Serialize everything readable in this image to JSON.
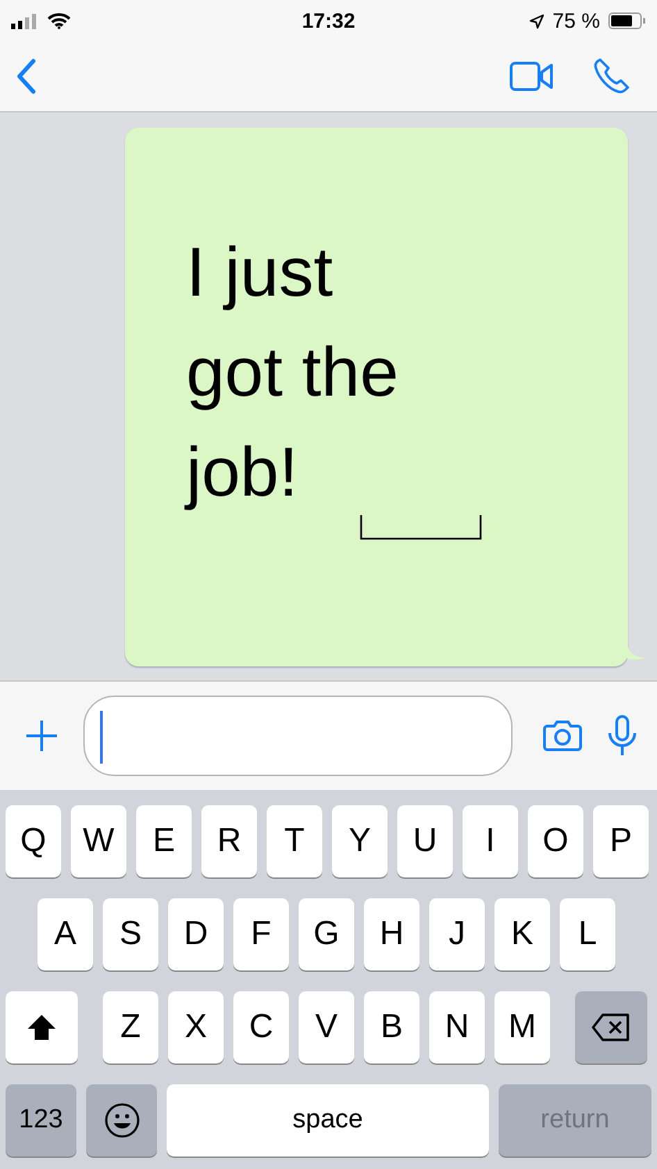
{
  "status_bar": {
    "time": "17:32",
    "battery": "75 %"
  },
  "message": {
    "text": "I just got the job!"
  },
  "keyboard": {
    "rows": [
      [
        {
          "kind": "letter",
          "label": "Q"
        },
        {
          "kind": "letter",
          "label": "W"
        },
        {
          "kind": "letter",
          "label": "E"
        },
        {
          "kind": "letter",
          "label": "R"
        },
        {
          "kind": "letter",
          "label": "T"
        },
        {
          "kind": "letter",
          "label": "Y"
        },
        {
          "kind": "letter",
          "label": "U"
        },
        {
          "kind": "letter",
          "label": "I"
        },
        {
          "kind": "letter",
          "label": "O"
        },
        {
          "kind": "letter",
          "label": "P"
        }
      ],
      [
        {
          "kind": "letter",
          "label": "A"
        },
        {
          "kind": "letter",
          "label": "S"
        },
        {
          "kind": "letter",
          "label": "D"
        },
        {
          "kind": "letter",
          "label": "F"
        },
        {
          "kind": "letter",
          "label": "G"
        },
        {
          "kind": "letter",
          "label": "H"
        },
        {
          "kind": "letter",
          "label": "J"
        },
        {
          "kind": "letter",
          "label": "K"
        },
        {
          "kind": "letter",
          "label": "L"
        }
      ],
      [
        {
          "kind": "shift"
        },
        {
          "kind": "letter",
          "label": "Z"
        },
        {
          "kind": "letter",
          "label": "X"
        },
        {
          "kind": "letter",
          "label": "C"
        },
        {
          "kind": "letter",
          "label": "V"
        },
        {
          "kind": "letter",
          "label": "B"
        },
        {
          "kind": "letter",
          "label": "N"
        },
        {
          "kind": "letter",
          "label": "M"
        },
        {
          "kind": "delete"
        }
      ]
    ],
    "bottom_row": [
      {
        "kind": "numbers",
        "label": "123"
      },
      {
        "kind": "emoji"
      },
      {
        "kind": "space",
        "label": "space"
      },
      {
        "kind": "return",
        "label": "return",
        "disabled": true
      }
    ]
  }
}
